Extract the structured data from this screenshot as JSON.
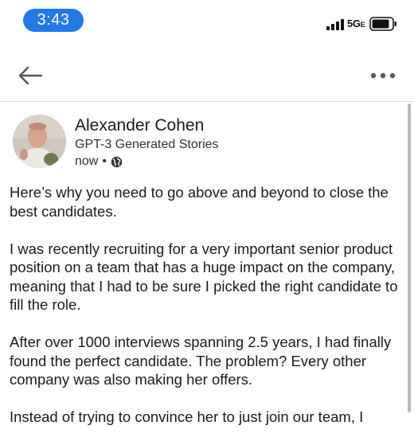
{
  "status_bar": {
    "time": "3:43",
    "network": "5G",
    "network_suffix": "E"
  },
  "nav": {
    "back_icon": "arrow-left-icon",
    "more_icon": "more-horizontal-icon"
  },
  "post": {
    "author": {
      "name": "Alexander Cohen",
      "subtitle": "GPT-3 Generated Stories"
    },
    "timestamp": "now",
    "separator": "•",
    "visibility_icon": "globe-icon",
    "paragraphs": [
      "Here’s why you need to go above and beyond to close the best candidates.",
      "I was recently recruiting for a very important senior product position on a team that has a huge impact on the company, meaning that I had to be sure I picked the right candidate to fill the role.",
      "After over 1000 interviews spanning 2.5 years, I had finally found the perfect candidate. The problem? Every other company was also making her offers.",
      "Instead of trying to convince her to just join our team, I"
    ]
  },
  "colors": {
    "time_pill": "#1f7ae8",
    "text": "#1b1b1b",
    "divider": "#d9d9d9"
  }
}
